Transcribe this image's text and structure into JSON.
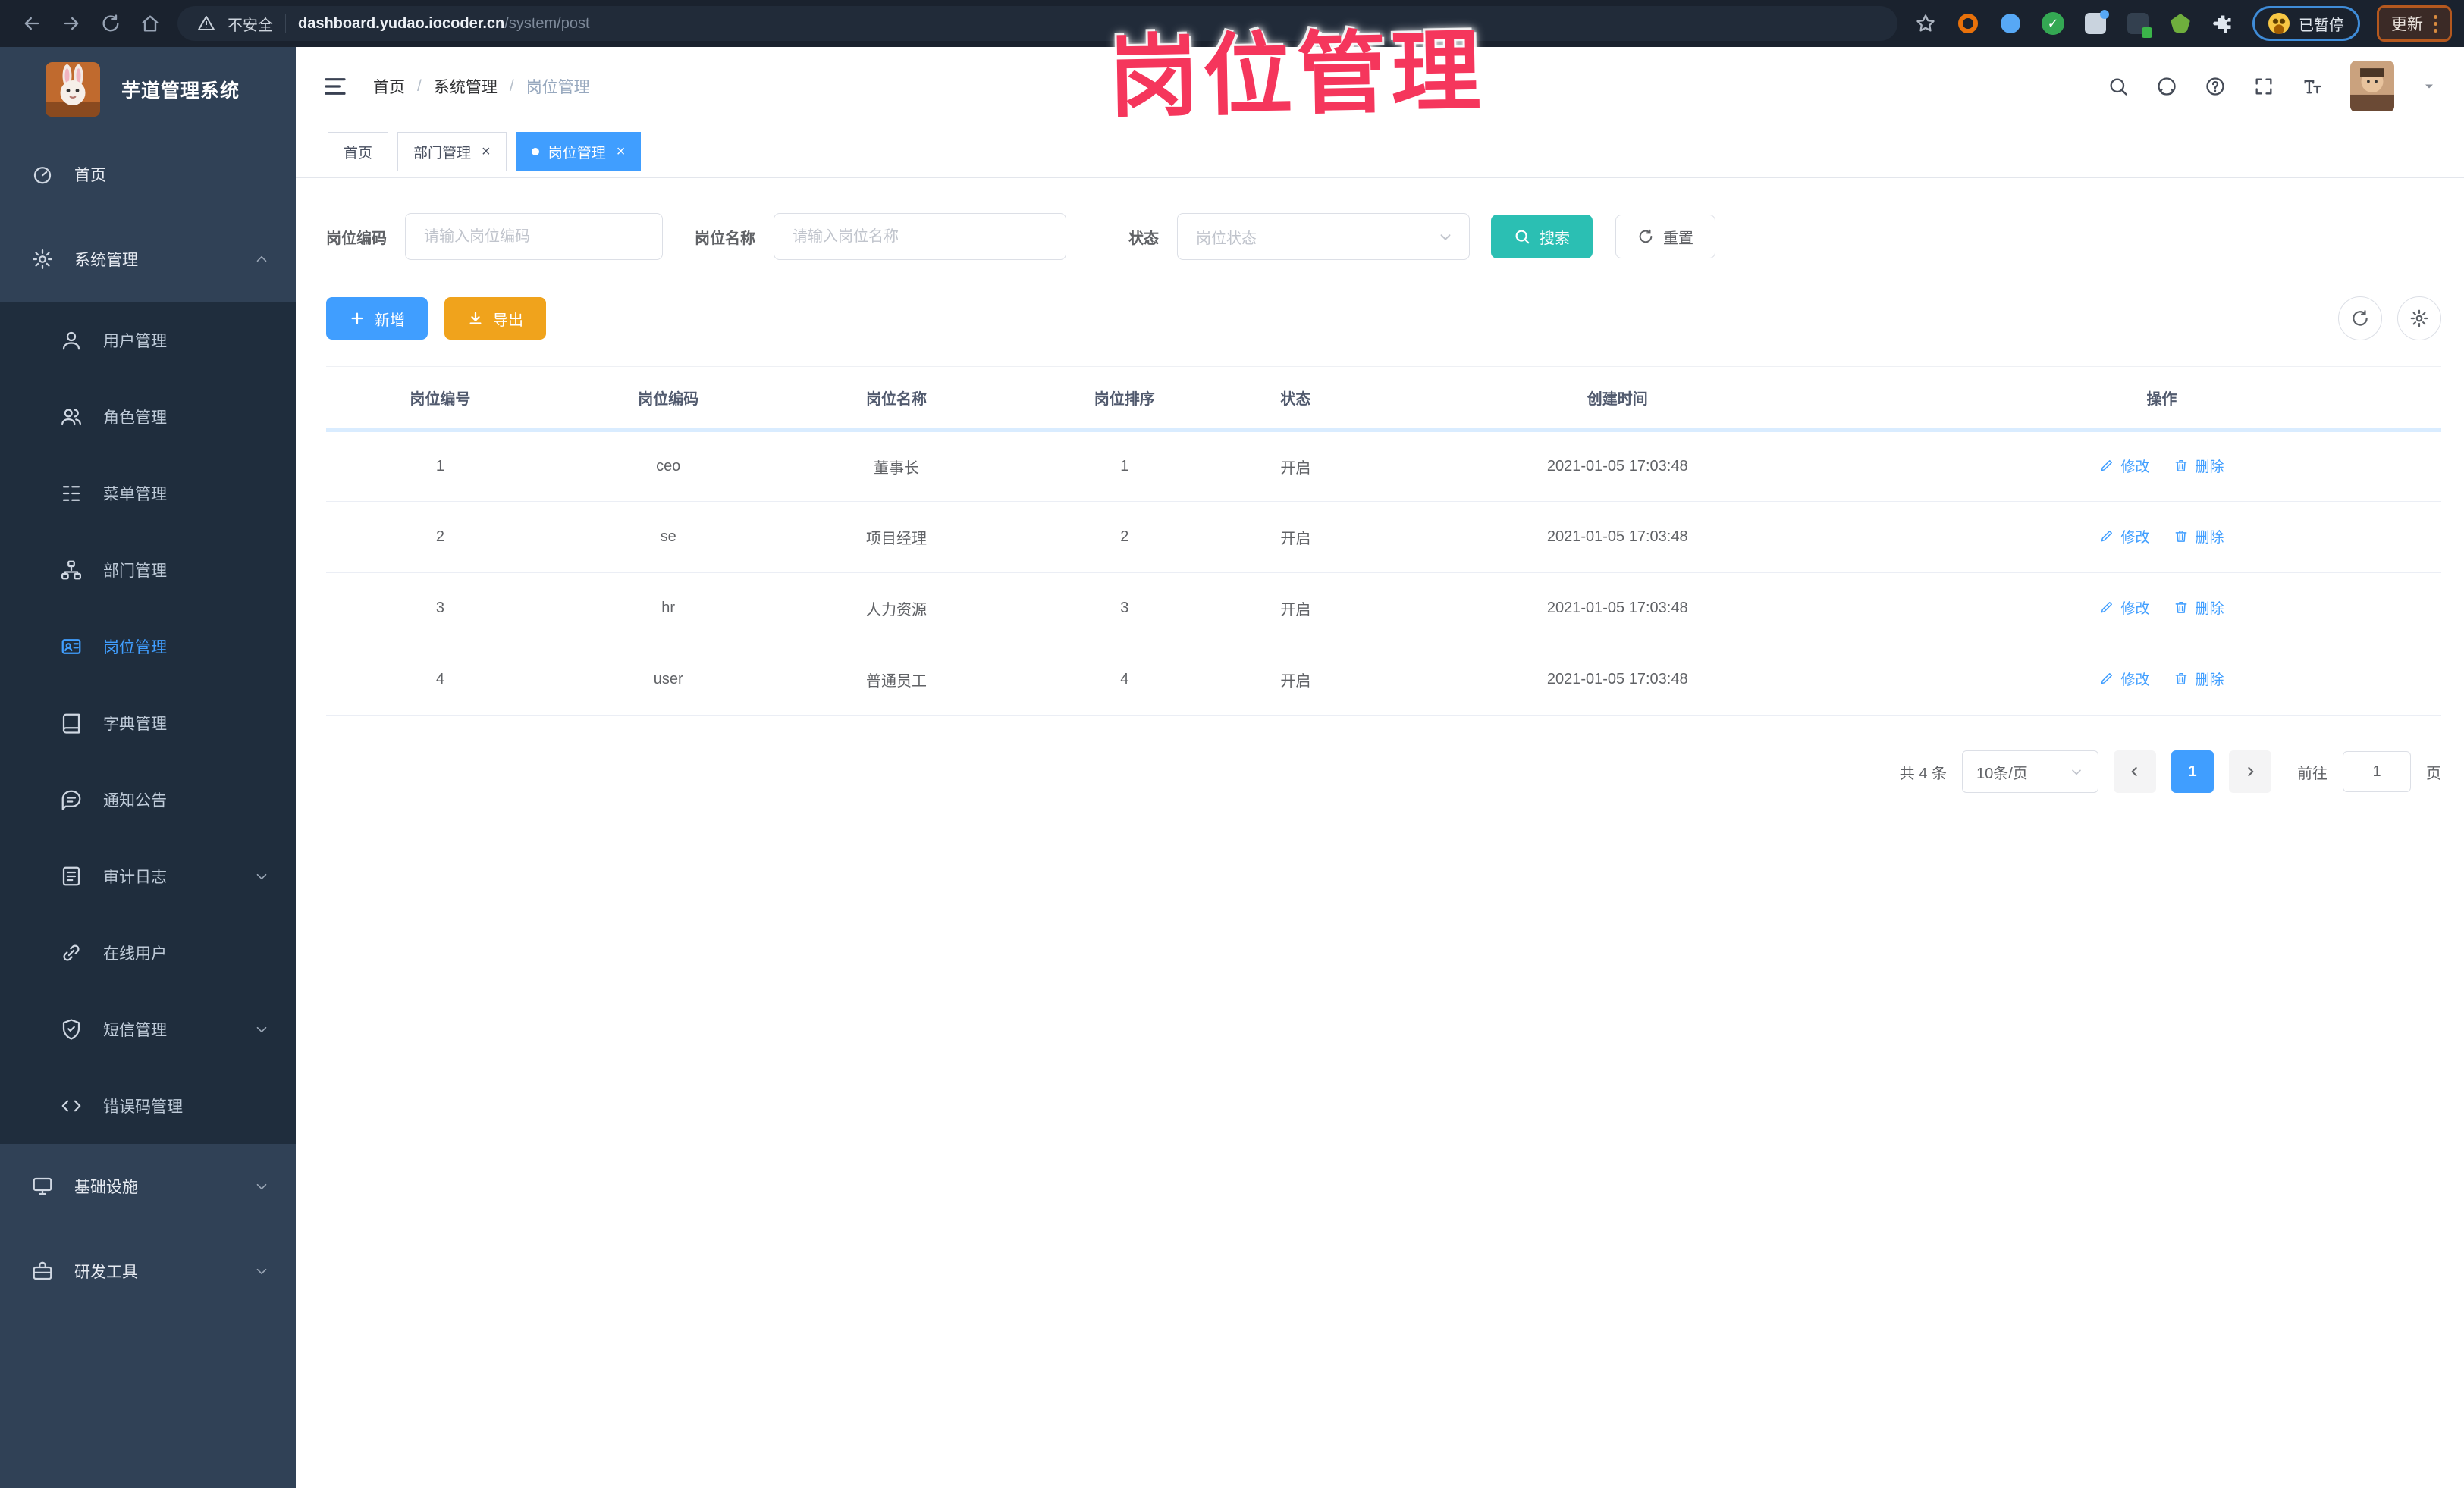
{
  "browser": {
    "security_label": "不安全",
    "url_host": "dashboard.yudao.iocoder.cn",
    "url_path": "/system/post",
    "paused_badge": "已暂停",
    "update_button": "更新"
  },
  "watermark": {
    "text": "岗位管理"
  },
  "sidebar": {
    "title": "芋道管理系统",
    "items": [
      {
        "name": "home",
        "label": "首页",
        "icon": "gauge-icon",
        "level": "top"
      },
      {
        "name": "system",
        "label": "系统管理",
        "icon": "gear-icon",
        "level": "top",
        "arrow": "up"
      },
      {
        "name": "user",
        "label": "用户管理",
        "icon": "user-icon",
        "level": "sub"
      },
      {
        "name": "role",
        "label": "角色管理",
        "icon": "role-icon",
        "level": "sub"
      },
      {
        "name": "menu",
        "label": "菜单管理",
        "icon": "menu-tree-icon",
        "level": "sub"
      },
      {
        "name": "dept",
        "label": "部门管理",
        "icon": "sitemap-icon",
        "level": "sub"
      },
      {
        "name": "post",
        "label": "岗位管理",
        "icon": "badge-icon",
        "level": "sub",
        "active": true
      },
      {
        "name": "dict",
        "label": "字典管理",
        "icon": "book-icon",
        "level": "sub"
      },
      {
        "name": "notice",
        "label": "通知公告",
        "icon": "comment-icon",
        "level": "sub"
      },
      {
        "name": "audit",
        "label": "审计日志",
        "icon": "log-icon",
        "level": "sub",
        "arrow": "down"
      },
      {
        "name": "online",
        "label": "在线用户",
        "icon": "link-icon",
        "level": "sub"
      },
      {
        "name": "sms",
        "label": "短信管理",
        "icon": "shield-icon",
        "level": "sub",
        "arrow": "down"
      },
      {
        "name": "errcode",
        "label": "错误码管理",
        "icon": "code-icon",
        "level": "sub"
      },
      {
        "name": "infra",
        "label": "基础设施",
        "icon": "monitor-icon",
        "level": "top",
        "arrow": "down"
      },
      {
        "name": "devtool",
        "label": "研发工具",
        "icon": "toolbox-icon",
        "level": "top",
        "arrow": "down"
      }
    ]
  },
  "header": {
    "breadcrumb": [
      "首页",
      "系统管理",
      "岗位管理"
    ]
  },
  "tabs": [
    {
      "label": "首页",
      "closable": false,
      "active": false
    },
    {
      "label": "部门管理",
      "closable": true,
      "active": false
    },
    {
      "label": "岗位管理",
      "closable": true,
      "active": true
    }
  ],
  "filters": {
    "code_label": "岗位编码",
    "code_placeholder": "请输入岗位编码",
    "name_label": "岗位名称",
    "name_placeholder": "请输入岗位名称",
    "status_label": "状态",
    "status_placeholder": "岗位状态",
    "search_label": "搜索",
    "reset_label": "重置"
  },
  "toolbar": {
    "add_label": "新增",
    "export_label": "导出"
  },
  "table": {
    "columns": [
      "岗位编号",
      "岗位编码",
      "岗位名称",
      "岗位排序",
      "状态",
      "创建时间",
      "操作"
    ],
    "edit_label": "修改",
    "delete_label": "删除",
    "rows": [
      {
        "id": "1",
        "code": "ceo",
        "name": "董事长",
        "sort": "1",
        "status": "开启",
        "created": "2021-01-05 17:03:48"
      },
      {
        "id": "2",
        "code": "se",
        "name": "项目经理",
        "sort": "2",
        "status": "开启",
        "created": "2021-01-05 17:03:48"
      },
      {
        "id": "3",
        "code": "hr",
        "name": "人力资源",
        "sort": "3",
        "status": "开启",
        "created": "2021-01-05 17:03:48"
      },
      {
        "id": "4",
        "code": "user",
        "name": "普通员工",
        "sort": "4",
        "status": "开启",
        "created": "2021-01-05 17:03:48"
      }
    ]
  },
  "pagination": {
    "total_text": "共 4 条",
    "page_size": "10条/页",
    "current_page": "1",
    "goto_label": "前往",
    "goto_value": "1",
    "page_unit": "页"
  },
  "colors": {
    "accent": "#409eff",
    "search_button": "#2bbfb3",
    "export_button": "#f0a31c",
    "watermark": "#f5365c",
    "sidebar_bg": "#304156",
    "submenu_bg": "#1f2d3d"
  }
}
